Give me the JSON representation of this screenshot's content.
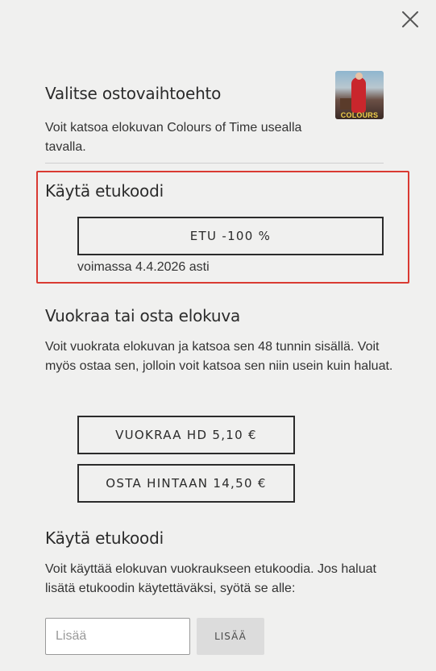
{
  "dialog": {
    "close_icon": "close-icon"
  },
  "options": {
    "title": "Valitse ostovaihtoehto",
    "description": "Voit katsoa elokuvan Colours of Time usealla tavalla.",
    "thumbnail_label": "COLOURS"
  },
  "coupon_applied": {
    "title": "Käytä etukoodi",
    "code_button": "ETU -100 %",
    "validity": "voimassa 4.4.2026 asti",
    "highlight_color": "#d93a32"
  },
  "rent_buy": {
    "title": "Vuokraa tai osta elokuva",
    "description": "Voit vuokrata elokuvan ja katsoa sen 48 tunnin sisällä. Voit myös ostaa sen, jolloin voit katsoa sen niin usein kuin haluat.",
    "rent_button": "VUOKRAA HD 5,10 €",
    "buy_button": "OSTA HINTAAN 14,50 €"
  },
  "coupon_entry": {
    "title": "Käytä etukoodi",
    "description": "Voit käyttää elokuvan vuokraukseen etukoodia. Jos haluat lisätä etukoodin käytettäväksi, syötä se alle:",
    "input_value": "",
    "input_placeholder": "Lisää",
    "add_button": "LISÄÄ"
  }
}
